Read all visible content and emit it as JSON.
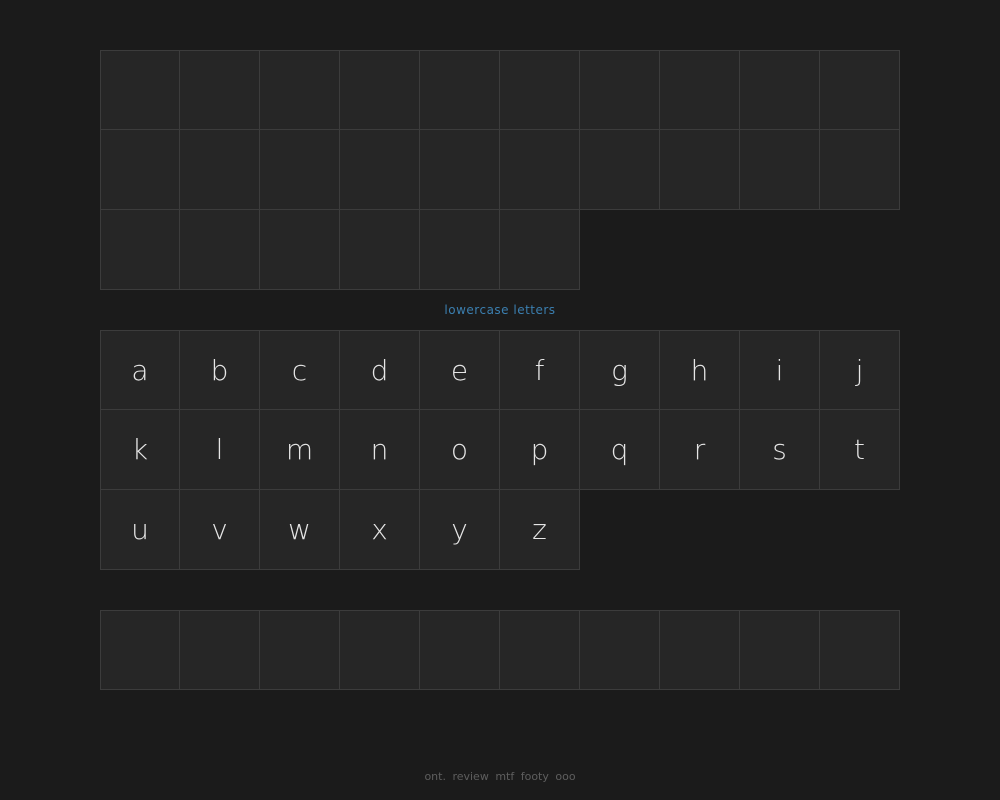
{
  "uppercase": {
    "label": "",
    "letters": [
      "",
      "",
      "",
      "",
      "",
      "",
      "",
      "",
      "",
      "",
      "",
      "",
      "",
      "",
      "",
      "",
      "",
      "",
      "",
      "",
      "",
      "",
      "",
      "",
      "",
      ""
    ]
  },
  "lowercase": {
    "label": "lowercase letters",
    "letters": [
      "a",
      "b",
      "c",
      "d",
      "e",
      "f",
      "g",
      "h",
      "i",
      "j",
      "k",
      "l",
      "m",
      "n",
      "o",
      "p",
      "q",
      "r",
      "s",
      "t",
      "u",
      "v",
      "w",
      "x",
      "y",
      "z"
    ]
  },
  "extra": {
    "letters": [
      "",
      "",
      "",
      "",
      "",
      "",
      "",
      "",
      "",
      ""
    ]
  },
  "footer": {
    "text": "ont. review mtf footy ooo"
  }
}
